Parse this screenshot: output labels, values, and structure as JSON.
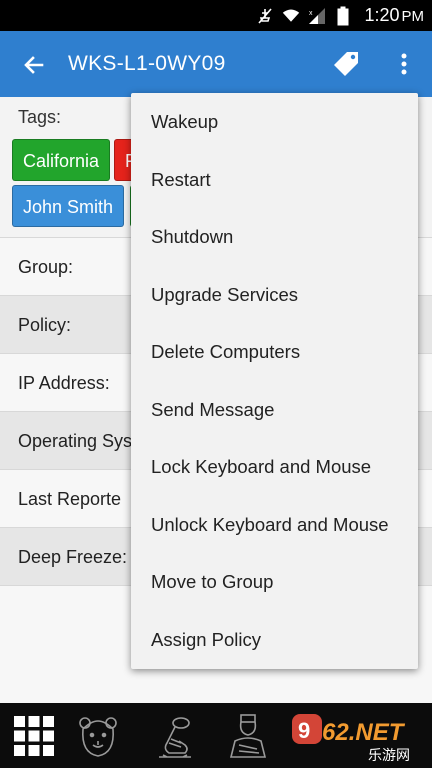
{
  "status_bar": {
    "time": "1:20",
    "ampm": "PM"
  },
  "app_bar": {
    "title": "WKS-L1-0WY09",
    "icons": [
      "back-arrow-icon",
      "tag-icon",
      "more-vert-icon"
    ]
  },
  "tags": {
    "label": "Tags:",
    "chips": [
      {
        "label": "California",
        "color": "#22a52c"
      },
      {
        "label": "F",
        "color": "#e5231b"
      },
      {
        "label": "John Smith",
        "color": "#3a8fd9"
      }
    ]
  },
  "details": {
    "rows": [
      {
        "label": "Group:"
      },
      {
        "label": "Policy:"
      },
      {
        "label": "IP Address:"
      },
      {
        "label": "Operating Sys"
      },
      {
        "label": "Last Reporte"
      },
      {
        "label": "Deep Freeze:"
      }
    ]
  },
  "menu": {
    "items": [
      "Wakeup",
      "Restart",
      "Shutdown",
      "Upgrade Services",
      "Delete Computers",
      "Send Message",
      "Lock Keyboard and Mouse",
      "Unlock Keyboard and Mouse",
      "Move to Group",
      "Assign Policy"
    ]
  },
  "bottom_nav": {
    "items": [
      "apps-grid-icon",
      "bear-icon",
      "ice-skate-icon",
      "person-icon"
    ]
  },
  "watermark": {
    "text": "962.NET",
    "subtext": "乐游网"
  },
  "colors": {
    "appbar": "#2f7fcf",
    "status_bar": "#000000",
    "bottom_nav": "#0c0c0c"
  }
}
